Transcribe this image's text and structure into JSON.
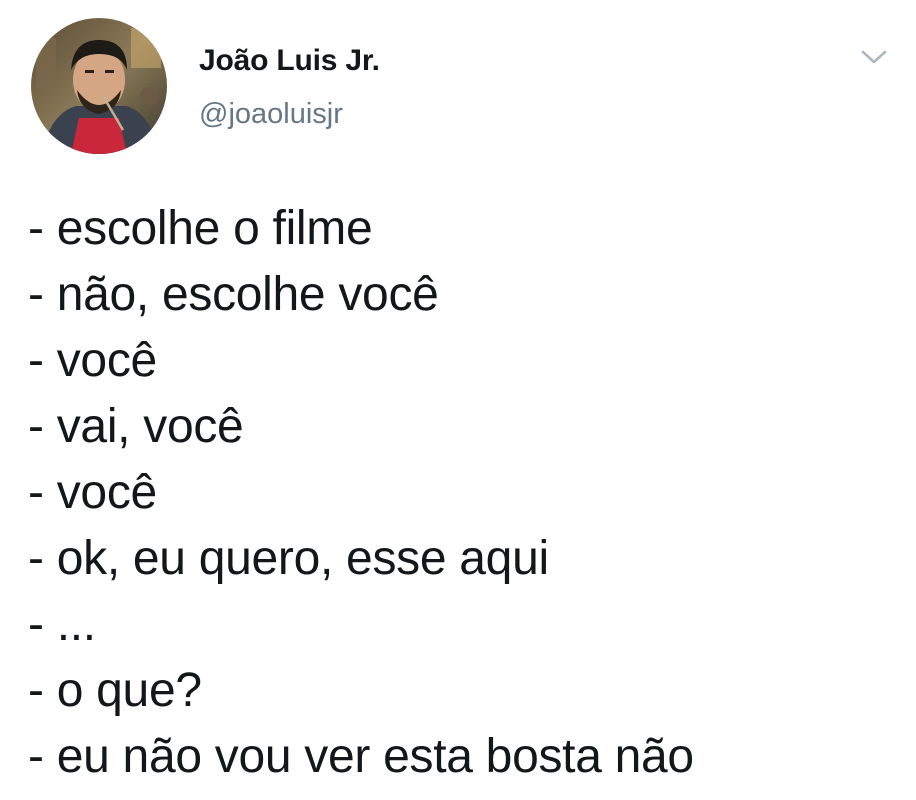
{
  "author": {
    "display_name": "João Luis Jr.",
    "handle": "@joaoluisjr",
    "avatar_icon": "profile-photo"
  },
  "menu": {
    "icon": "chevron-down-icon",
    "color": "#aab8c2"
  },
  "tweet": {
    "lines": [
      "- escolhe o filme",
      "- não, escolhe você",
      "- você",
      "- vai, você",
      "- você",
      "- ok, eu quero, esse aqui",
      "- ...",
      "- o que?",
      "- eu não vou ver esta bosta não"
    ]
  },
  "colors": {
    "text": "#14171a",
    "handle": "#657786",
    "background": "#ffffff"
  }
}
